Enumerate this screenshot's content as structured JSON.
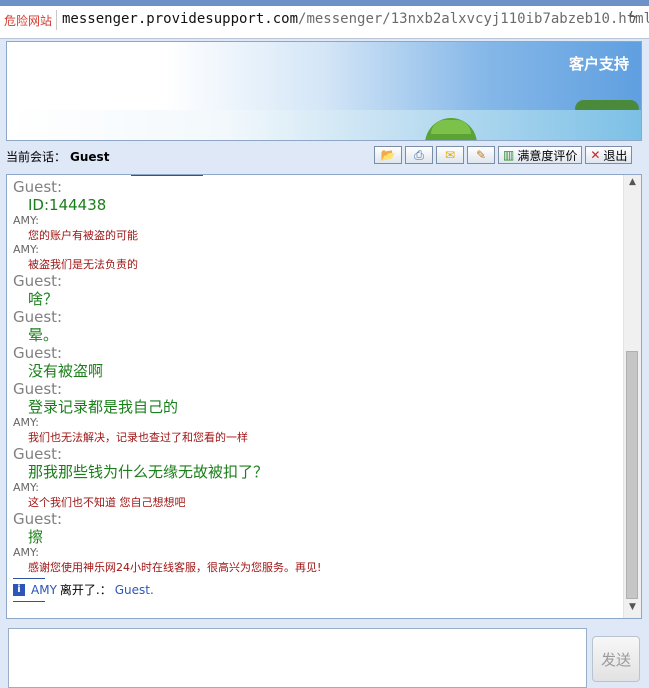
{
  "browser": {
    "danger_label": "危险网站",
    "url_host": "messenger.providesupport.com",
    "url_path": "/messenger/13nxb2alxvcyj110ib7abzeb10.html",
    "icon": "lightning-icon"
  },
  "banner": {
    "title": "客户支持"
  },
  "session": {
    "label": "当前会话：",
    "name": "Guest"
  },
  "toolbar": {
    "send_file_icon": "send-file-icon",
    "print_icon": "print-icon",
    "email_icon": "email-icon",
    "sign_icon": "sign-icon",
    "rate_label": "满意度评价",
    "exit_label": "退出"
  },
  "transcript": {
    "messages": [
      {
        "sender": "Guest:",
        "text": "ID:144438"
      },
      {
        "sender": "AMY:",
        "text": "您的账户有被盗的可能"
      },
      {
        "sender": "AMY:",
        "text": "被盗我们是无法负责的"
      },
      {
        "sender": "Guest:",
        "text": "啥？"
      },
      {
        "sender": "Guest:",
        "text": "晕。"
      },
      {
        "sender": "Guest:",
        "text": "没有被盗啊"
      },
      {
        "sender": "Guest:",
        "text": "登录记录都是我自己的"
      },
      {
        "sender": "AMY:",
        "text": "我们也无法解决，记录也查过了和您看的一样"
      },
      {
        "sender": "Guest:",
        "text": "那我那些钱为什么无缘无故被扣了？"
      },
      {
        "sender": "AMY:",
        "text": "这个我们也不知道 您自己想想吧"
      },
      {
        "sender": "Guest:",
        "text": "擦"
      },
      {
        "sender": "AMY:",
        "text": "感谢您使用神乐网24小时在线客服，很高兴为您服务。再见!"
      }
    ],
    "system": {
      "info_icon": "i",
      "name": "AMY",
      "action": "离开了.：",
      "target": "Guest."
    }
  },
  "compose": {
    "send_label": "发送"
  },
  "colors": {
    "guest_text": "#1a7f1a",
    "amy_text": "#a01616",
    "accent": "#2d56b8"
  }
}
